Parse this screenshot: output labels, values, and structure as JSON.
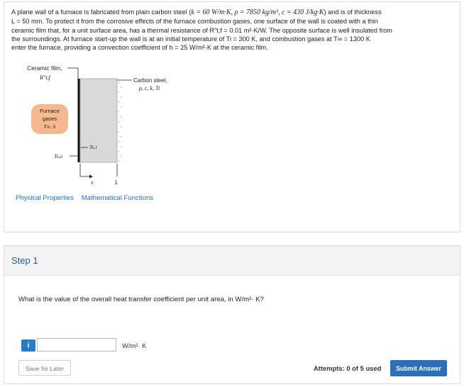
{
  "problem": {
    "text_1": "A plane wall of a furnace is fabricated from plain carbon steel (",
    "k_value": "k = 60 W/m·K, ρ = 7850 kg/m³, c = 430 J/kg·K",
    "text_2": ") and is of thickness",
    "line2": "L = 50 mm. To protect it from the corrosive effects of the furnace combustion gases, one surface of the wall is coated with a thin",
    "line3": "ceramic film that, for a unit surface area, has a thermal resistance of R″t,f = 0.01 m²·K/W. The opposite surface is well insulated from",
    "line4": "the surroundings. At furnace start-up the wall is at an initial temperature of Ti = 300 K, and combustion gases at T∞ = 1300 K",
    "line5": "enter the furnace, providing a convection coefficient of h = 25 W/m²·K at the ceramic film."
  },
  "figure": {
    "ceramic_label": "Ceramic film,",
    "ceramic_symbol": "R″t,f",
    "steel_label": "Carbon steel,",
    "steel_props": "ρ, c, k, Ti",
    "furnace_line1": "Furnace",
    "furnace_line2": "gases",
    "furnace_line3": "T∞, h",
    "ts_o": "Ts,o",
    "ts_i": "Ts,i",
    "x_label": "x",
    "L_label": "L",
    "accent_orange": "#f6b88f",
    "wall_gray": "#d9d9d9"
  },
  "links": {
    "physical": "Physical Properties",
    "math": "Mathematical Functions"
  },
  "step": {
    "title": "Step 1",
    "question": "What is the value of the overall heat transfer coefficient per unit area, in W/m²· K?",
    "answer_value": "",
    "unit": "W/m²· K",
    "info_icon": "i",
    "save_label": "Save for Later",
    "attempts": "Attempts: 0 of 5 used",
    "submit_label": "Submit Answer"
  }
}
